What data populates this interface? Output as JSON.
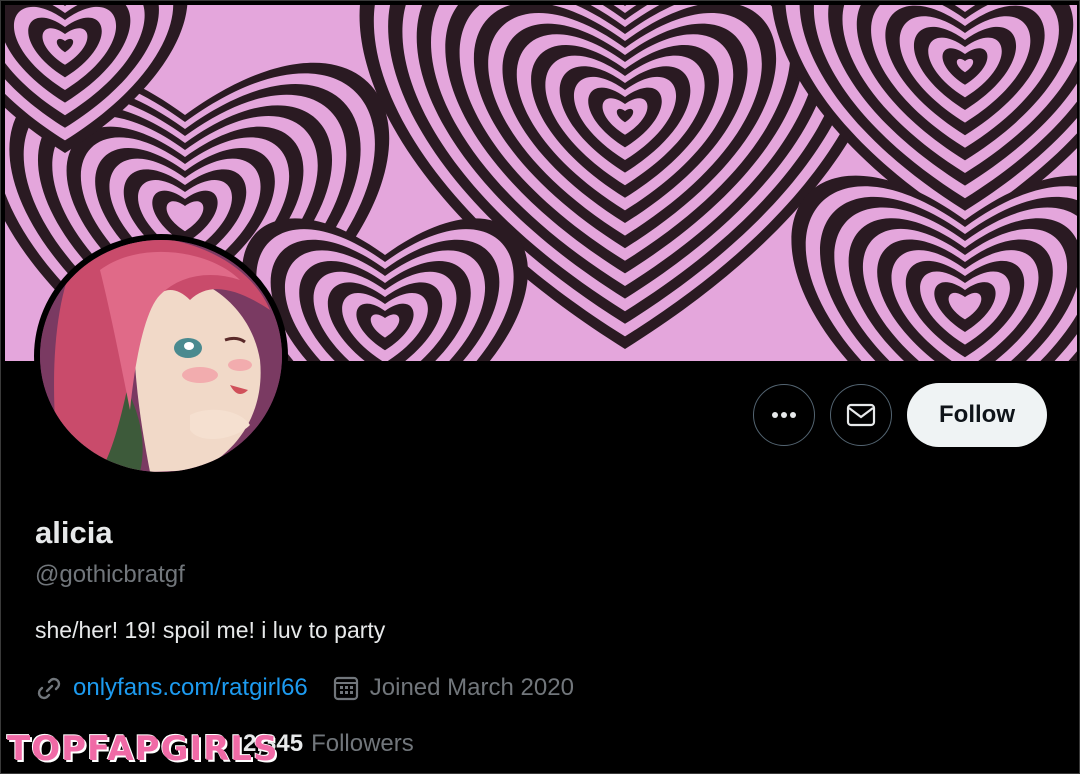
{
  "profile": {
    "display_name": "alicia",
    "handle": "@gothicbratgf",
    "bio": "she/her! 19! spoil me! i luv to party",
    "website": "onlyfans.com/ratgirl66",
    "joined": "Joined March 2020",
    "followers_count": "2,345",
    "followers_label": "Followers"
  },
  "actions": {
    "more_icon": "more-horizontal-icon",
    "message_icon": "envelope-icon",
    "follow_label": "Follow"
  },
  "icons": {
    "link": "link-icon",
    "calendar": "calendar-icon"
  },
  "watermark": "TOPFAPGIRLS",
  "colors": {
    "background": "#000000",
    "banner_pink": "#e4a6dc",
    "banner_dark": "#2a1a22",
    "link_blue": "#1d9bf0",
    "muted": "#71767b",
    "follow_bg": "#eff3f4",
    "watermark": "#f06aa6"
  }
}
